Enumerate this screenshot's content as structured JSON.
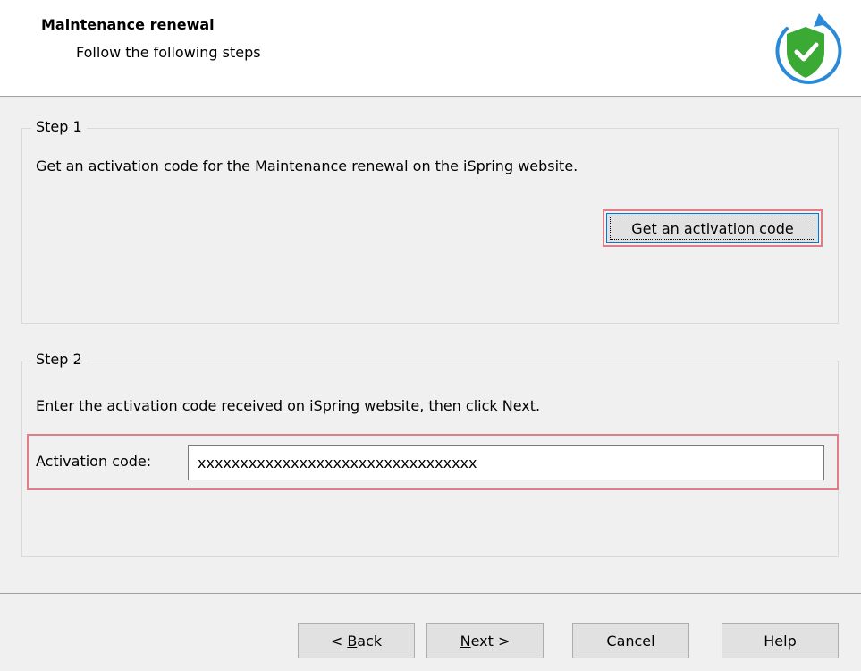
{
  "header": {
    "title": "Maintenance renewal",
    "subtitle": "Follow the following steps",
    "logo_icon": "shield-check-refresh-icon",
    "colors": {
      "shield": "#3aaa35",
      "ring": "#2b8ad8"
    }
  },
  "step1": {
    "legend": "Step 1",
    "description": "Get an activation code for the Maintenance renewal on the iSpring website.",
    "button_label": "Get an activation code"
  },
  "step2": {
    "legend": "Step 2",
    "description": "Enter the activation code received on iSpring website, then click Next.",
    "field_label": "Activation code:",
    "field_value": "xxxxxxxxxxxxxxxxxxxxxxxxxxxxxxxxx"
  },
  "footer": {
    "back": {
      "prefix": "< ",
      "accel": "B",
      "rest": "ack"
    },
    "next": {
      "accel": "N",
      "rest": "ext >"
    },
    "cancel": "Cancel",
    "help": "Help"
  },
  "highlight_color": "#e07d86"
}
